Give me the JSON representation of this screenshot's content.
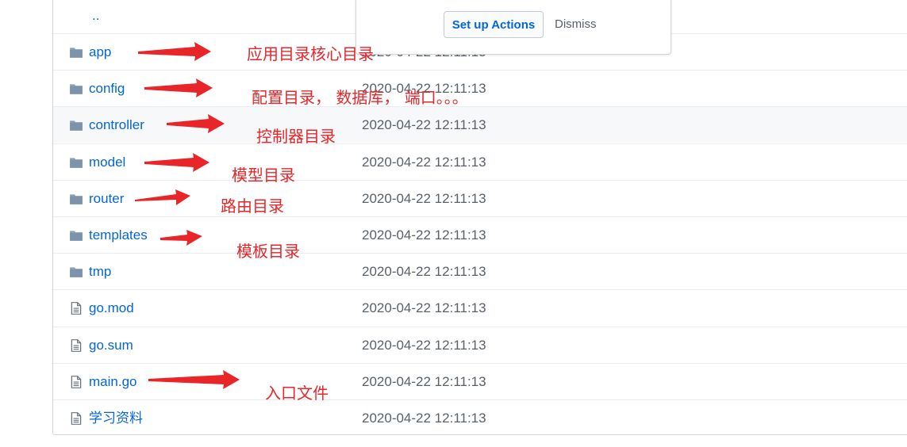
{
  "file_list": {
    "parent_link": "..",
    "rows": [
      {
        "name": "app",
        "type": "dir",
        "date": "2020-04-22 12:11:13"
      },
      {
        "name": "config",
        "type": "dir",
        "date": "2020-04-22 12:11:13"
      },
      {
        "name": "controller",
        "type": "dir",
        "date": "2020-04-22 12:11:13"
      },
      {
        "name": "model",
        "type": "dir",
        "date": "2020-04-22 12:11:13"
      },
      {
        "name": "router",
        "type": "dir",
        "date": "2020-04-22 12:11:13"
      },
      {
        "name": "templates",
        "type": "dir",
        "date": "2020-04-22 12:11:13"
      },
      {
        "name": "tmp",
        "type": "dir",
        "date": "2020-04-22 12:11:13"
      },
      {
        "name": "go.mod",
        "type": "file",
        "date": "2020-04-22 12:11:13"
      },
      {
        "name": "go.sum",
        "type": "file",
        "date": "2020-04-22 12:11:13"
      },
      {
        "name": "main.go",
        "type": "file",
        "date": "2020-04-22 12:11:13"
      },
      {
        "name": "学习资料",
        "type": "file",
        "date": "2020-04-22 12:11:13"
      }
    ]
  },
  "actions_banner": {
    "setup_label": "Set up Actions",
    "dismiss_label": "Dismiss"
  },
  "annotations": [
    {
      "text": "应用目录核心目录"
    },
    {
      "text": "配置目录， 数据库， 端口。。。"
    },
    {
      "text": "控制器目录"
    },
    {
      "text": "模型目录"
    },
    {
      "text": "路由目录"
    },
    {
      "text": "模板目录"
    },
    {
      "text": "入口文件"
    }
  ],
  "colors": {
    "link": "#0366d6",
    "muted": "#586069",
    "annotation": "#e8262a",
    "folder_icon": "#79b8ff"
  }
}
